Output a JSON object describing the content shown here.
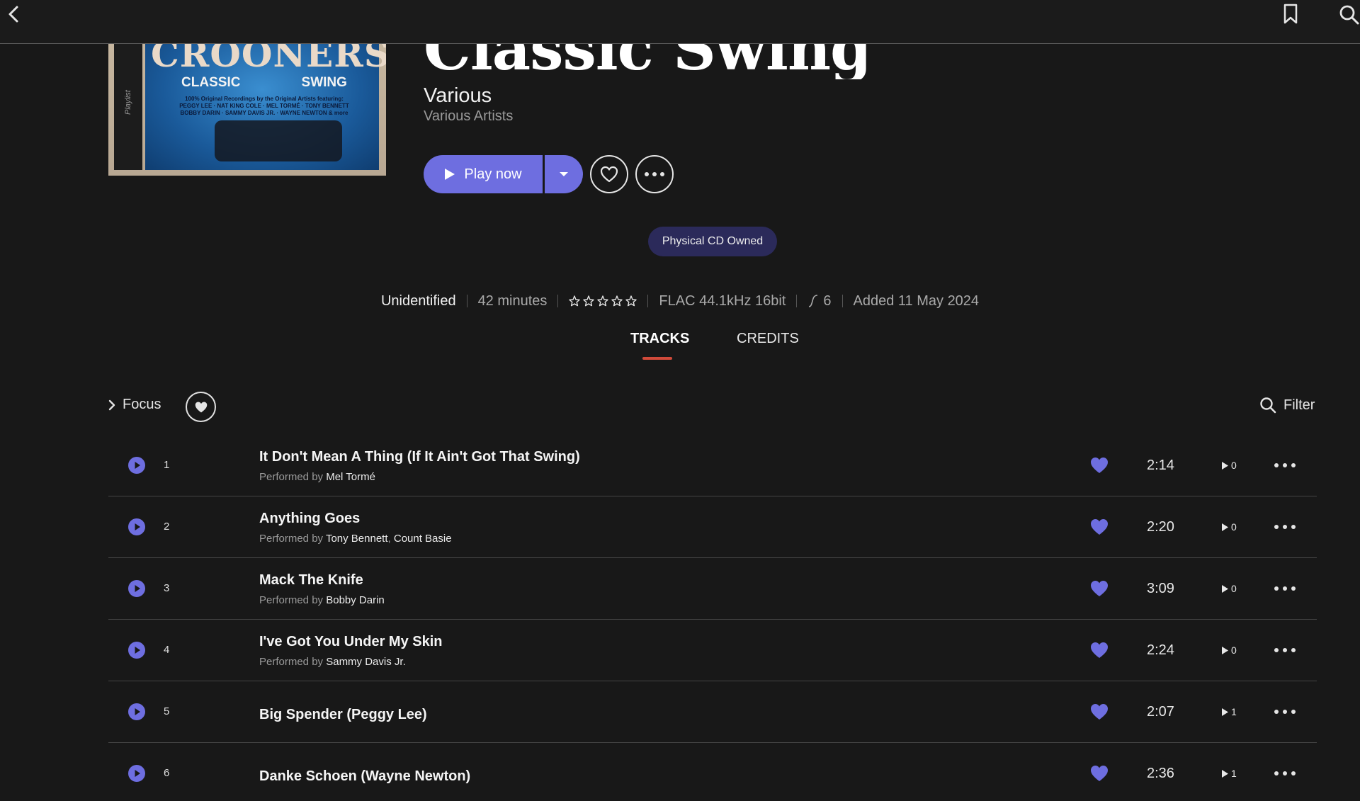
{
  "album": {
    "title": "Classic Swing",
    "artist": "Various",
    "artist_sub": "Various Artists",
    "cover": {
      "brand": "CROONERS",
      "left": "CLASSIC",
      "right": "SWING",
      "spine": "Playlist",
      "fine_1": "100% Original Recordings by the Original Artists featuring:",
      "fine_2": "PEGGY LEE · NAT KING COLE · MEL TORMÉ · TONY BENNETT",
      "fine_3": "BOBBY DARIN · SAMMY DAVIS JR. · WAYNE NEWTON & more"
    }
  },
  "actions": {
    "play_label": "Play now"
  },
  "badge": "Physical CD Owned",
  "meta": {
    "status": "Unidentified",
    "duration": "42 minutes",
    "rating_stars": 0,
    "format": "FLAC 44.1kHz 16bit",
    "wave_count": "6",
    "added": "Added 11 May 2024"
  },
  "tabs": [
    {
      "label": "TRACKS",
      "active": true
    },
    {
      "label": "CREDITS",
      "active": false
    }
  ],
  "toolbar": {
    "focus_label": "Focus",
    "filter_label": "Filter"
  },
  "performed_prefix": "Performed by",
  "colors": {
    "accent": "#6e6ee0",
    "tab_underline": "#d14a3a",
    "badge_bg": "#2b2a5a",
    "background": "#181818"
  },
  "tracks": [
    {
      "num": "1",
      "title": "It Don't Mean A Thing (If It Ain't Got That Swing)",
      "performers": [
        "Mel Tormé"
      ],
      "duration": "2:14",
      "plays": "0"
    },
    {
      "num": "2",
      "title": "Anything Goes",
      "performers": [
        "Tony Bennett",
        "Count Basie"
      ],
      "duration": "2:20",
      "plays": "0"
    },
    {
      "num": "3",
      "title": "Mack The Knife",
      "performers": [
        "Bobby Darin"
      ],
      "duration": "3:09",
      "plays": "0"
    },
    {
      "num": "4",
      "title": "I've Got You Under My Skin",
      "performers": [
        "Sammy Davis Jr."
      ],
      "duration": "2:24",
      "plays": "0"
    },
    {
      "num": "5",
      "title": "Big Spender (Peggy Lee)",
      "performers": [],
      "duration": "2:07",
      "plays": "1"
    },
    {
      "num": "6",
      "title": "Danke Schoen (Wayne Newton)",
      "performers": [],
      "duration": "2:36",
      "plays": "1"
    }
  ]
}
